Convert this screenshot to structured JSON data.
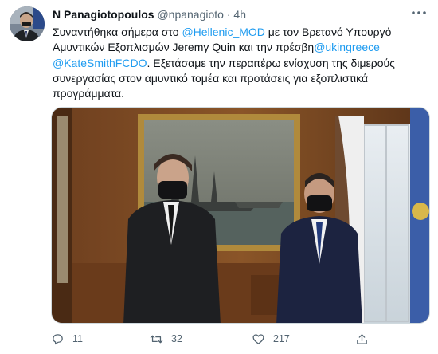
{
  "tweet": {
    "author_name": "N Panagiotopoulos",
    "handle": "@npanagioto",
    "separator": "·",
    "time": "4h",
    "text_1": "Συναντήθηκα σήμερα στο ",
    "mention_1": "@Hellenic_MOD",
    "text_2": " με τον Βρετανό Υπουργό Αμυντικών Εξοπλισμών Jeremy Quin και την πρέσβη",
    "mention_2": "@ukingreece",
    "text_3": " ",
    "mention_3": "@KateSmithFCDO",
    "text_4": ". Εξετάσαμε την περαιτέρω ενίσχυση της διμερούς συνεργασίας στον αμυντικό τομέα και προτάσεις για εξοπλιστικά προγράμματα."
  },
  "actions": {
    "reply_count": "11",
    "retweet_count": "32",
    "like_count": "217"
  },
  "icons": {
    "more": "more-horizontal-icon",
    "reply": "reply-icon",
    "retweet": "retweet-icon",
    "like": "heart-icon",
    "share": "share-icon"
  },
  "colors": {
    "link": "#1d9bf0",
    "secondary_text": "#536471",
    "primary_text": "#0f1419"
  }
}
